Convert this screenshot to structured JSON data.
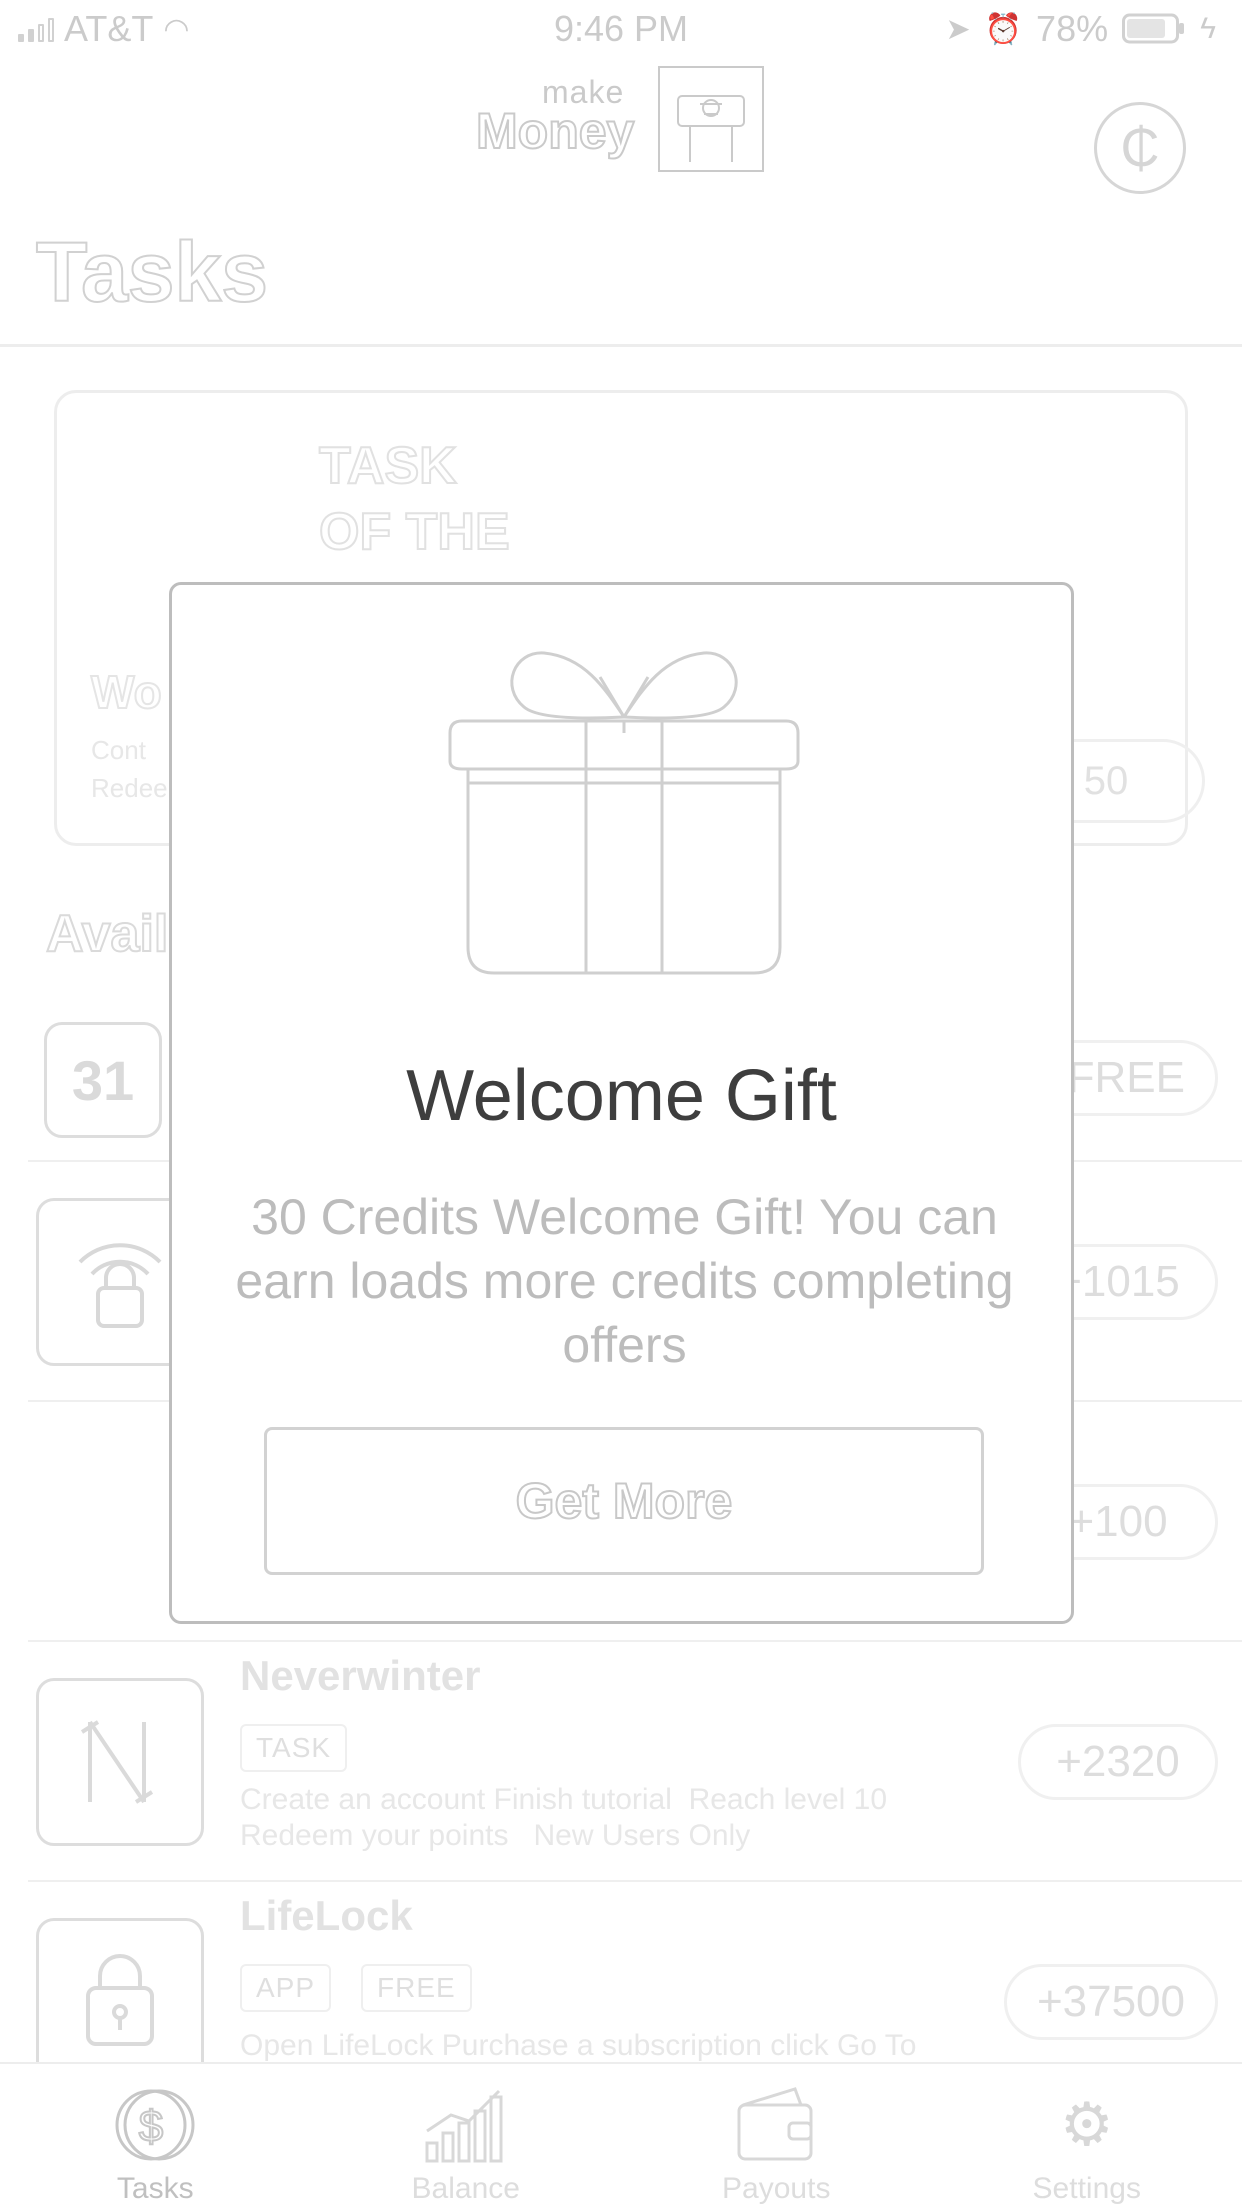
{
  "status_bar": {
    "carrier": "AT&T",
    "time": "9:46 PM",
    "battery": "78%"
  },
  "header": {
    "logo_make": "make",
    "logo_money": "Money",
    "page_title": "Tasks"
  },
  "task_of_the_day": {
    "title": "TASK\nOF THE",
    "name": "Wo",
    "description": "Cont\nRedee",
    "reward": "50"
  },
  "section_title": "Avail",
  "list": [
    {
      "icon_text": "31",
      "reward": "0 FREE"
    },
    {
      "reward": "+1015"
    },
    {
      "reward": "+100"
    },
    {
      "name": "Neverwinter",
      "tags": [
        "TASK"
      ],
      "description": "Create an account Finish tutorial  Reach level 10\nRedeem your points   New Users Only",
      "reward": "+2320"
    },
    {
      "name": "LifeLock",
      "tags": [
        "APP",
        "FREE"
      ],
      "description": "Open LifeLock Purchase a subscription click Go To",
      "reward": "+37500"
    }
  ],
  "tab_bar": {
    "tabs": [
      {
        "label": "Tasks",
        "active": true
      },
      {
        "label": "Balance",
        "active": false
      },
      {
        "label": "Payouts",
        "active": false
      },
      {
        "label": "Settings",
        "active": false
      }
    ]
  },
  "modal": {
    "title": "Welcome Gift",
    "message": "30 Credits Welcome Gift! You can earn loads more credits completing offers",
    "button_label": "Get More"
  }
}
